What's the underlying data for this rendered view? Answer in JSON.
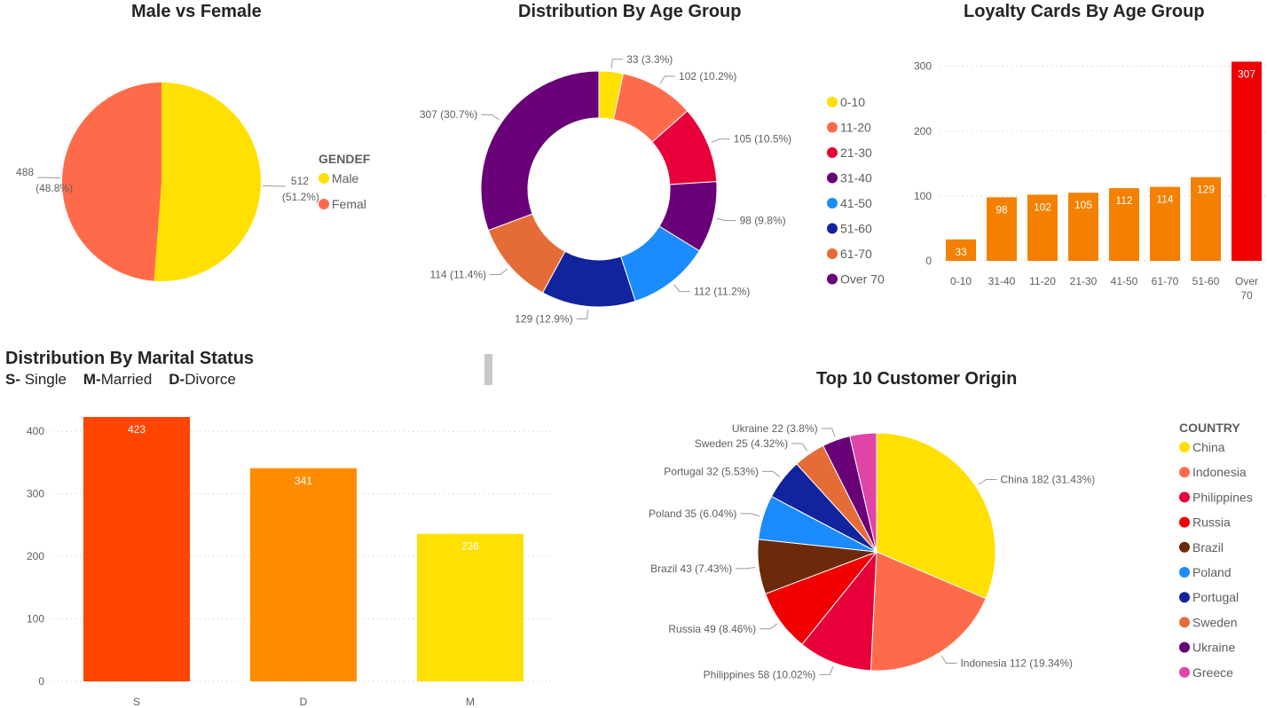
{
  "titles": {
    "gender": "Male vs Female",
    "age": "Distribution By Age Group",
    "loyalty": "Loyalty Cards By Age Group",
    "marital": "Distribution By Marital Status",
    "origin": "Top 10 Customer Origin"
  },
  "marital_subtitle": {
    "s_key": "S-",
    "s_val": " Single",
    "m_key": "M-",
    "m_val": "Married",
    "d_key": "D-",
    "d_val": "Divorce"
  },
  "legends": {
    "gender_title": "GENDEF",
    "country_title": "COUNTRY"
  },
  "colors": {
    "male": "#FFE000",
    "female": "#FF6B4A",
    "age": [
      "#FFE000",
      "#FF6B4A",
      "#E8003A",
      "#6A0078",
      "#1A8CFF",
      "#12239E",
      "#E66C37",
      "#6A0078"
    ],
    "loyalty_bar": "#F48000",
    "loyalty_max": "#F00000",
    "marital": [
      "#FF4500",
      "#FF8C00",
      "#FFE000"
    ],
    "country": [
      "#FFE000",
      "#FF6B4A",
      "#E8003A",
      "#F00000",
      "#6B2A0A",
      "#1A8CFF",
      "#12239E",
      "#E66C37",
      "#6A0078",
      "#E044A7"
    ]
  },
  "chart_data": [
    {
      "id": "gender",
      "type": "pie",
      "title": "Male vs Female",
      "legend_title": "GENDEF",
      "categories": [
        "Male",
        "Femal"
      ],
      "values": [
        512,
        488
      ],
      "labels": [
        "512",
        "488"
      ],
      "percent_labels": [
        "(51.2%)",
        "(48.8%)"
      ],
      "legend": "right"
    },
    {
      "id": "age",
      "type": "pie",
      "donut": true,
      "title": "Distribution By Age Group",
      "categories": [
        "0-10",
        "11-20",
        "21-30",
        "31-40",
        "41-50",
        "51-60",
        "61-70",
        "Over 70"
      ],
      "values": [
        33,
        102,
        105,
        98,
        112,
        129,
        114,
        307
      ],
      "labels": [
        "33 (3.3%)",
        "102 (10.2%)",
        "105 (10.5%)",
        "98 (9.8%)",
        "112 (11.2%)",
        "129 (12.9%)",
        "114 (11.4%)",
        "307 (30.7%)"
      ],
      "legend": "right"
    },
    {
      "id": "loyalty",
      "type": "bar",
      "title": "Loyalty Cards By Age Group",
      "categories": [
        "0-10",
        "31-40",
        "11-20",
        "21-30",
        "41-50",
        "61-70",
        "51-60",
        "Over 70"
      ],
      "values": [
        33,
        98,
        102,
        105,
        112,
        114,
        129,
        307
      ],
      "yticks": [
        "0",
        "100",
        "200",
        "300"
      ],
      "ylim": [
        0,
        320
      ],
      "grid": true
    },
    {
      "id": "marital",
      "type": "bar",
      "title": "Distribution By Marital Status",
      "categories": [
        "S",
        "D",
        "M"
      ],
      "values": [
        423,
        341,
        236
      ],
      "yticks": [
        "0",
        "100",
        "200",
        "300",
        "400"
      ],
      "ylim": [
        0,
        440
      ],
      "grid": true
    },
    {
      "id": "origin",
      "type": "pie",
      "title": "Top 10 Customer Origin",
      "legend_title": "COUNTRY",
      "categories": [
        "China",
        "Indonesia",
        "Philippines",
        "Russia",
        "Brazil",
        "Poland",
        "Portugal",
        "Sweden",
        "Ukraine",
        "Greece"
      ],
      "values": [
        182,
        112,
        58,
        49,
        43,
        35,
        32,
        25,
        22,
        21
      ],
      "labels": [
        "China 182 (31.43%)",
        "Indonesia 112 (19.34%)",
        "Philippines 58 (10.02%)",
        "Russia 49 (8.46%)",
        "Brazil 43 (7.43%)",
        "Poland 35 (6.04%)",
        "Portugal 32 (5.53%)",
        "Sweden 25 (4.32%)",
        "Ukraine 22 (3.8%)",
        ""
      ],
      "legend": "right"
    }
  ]
}
